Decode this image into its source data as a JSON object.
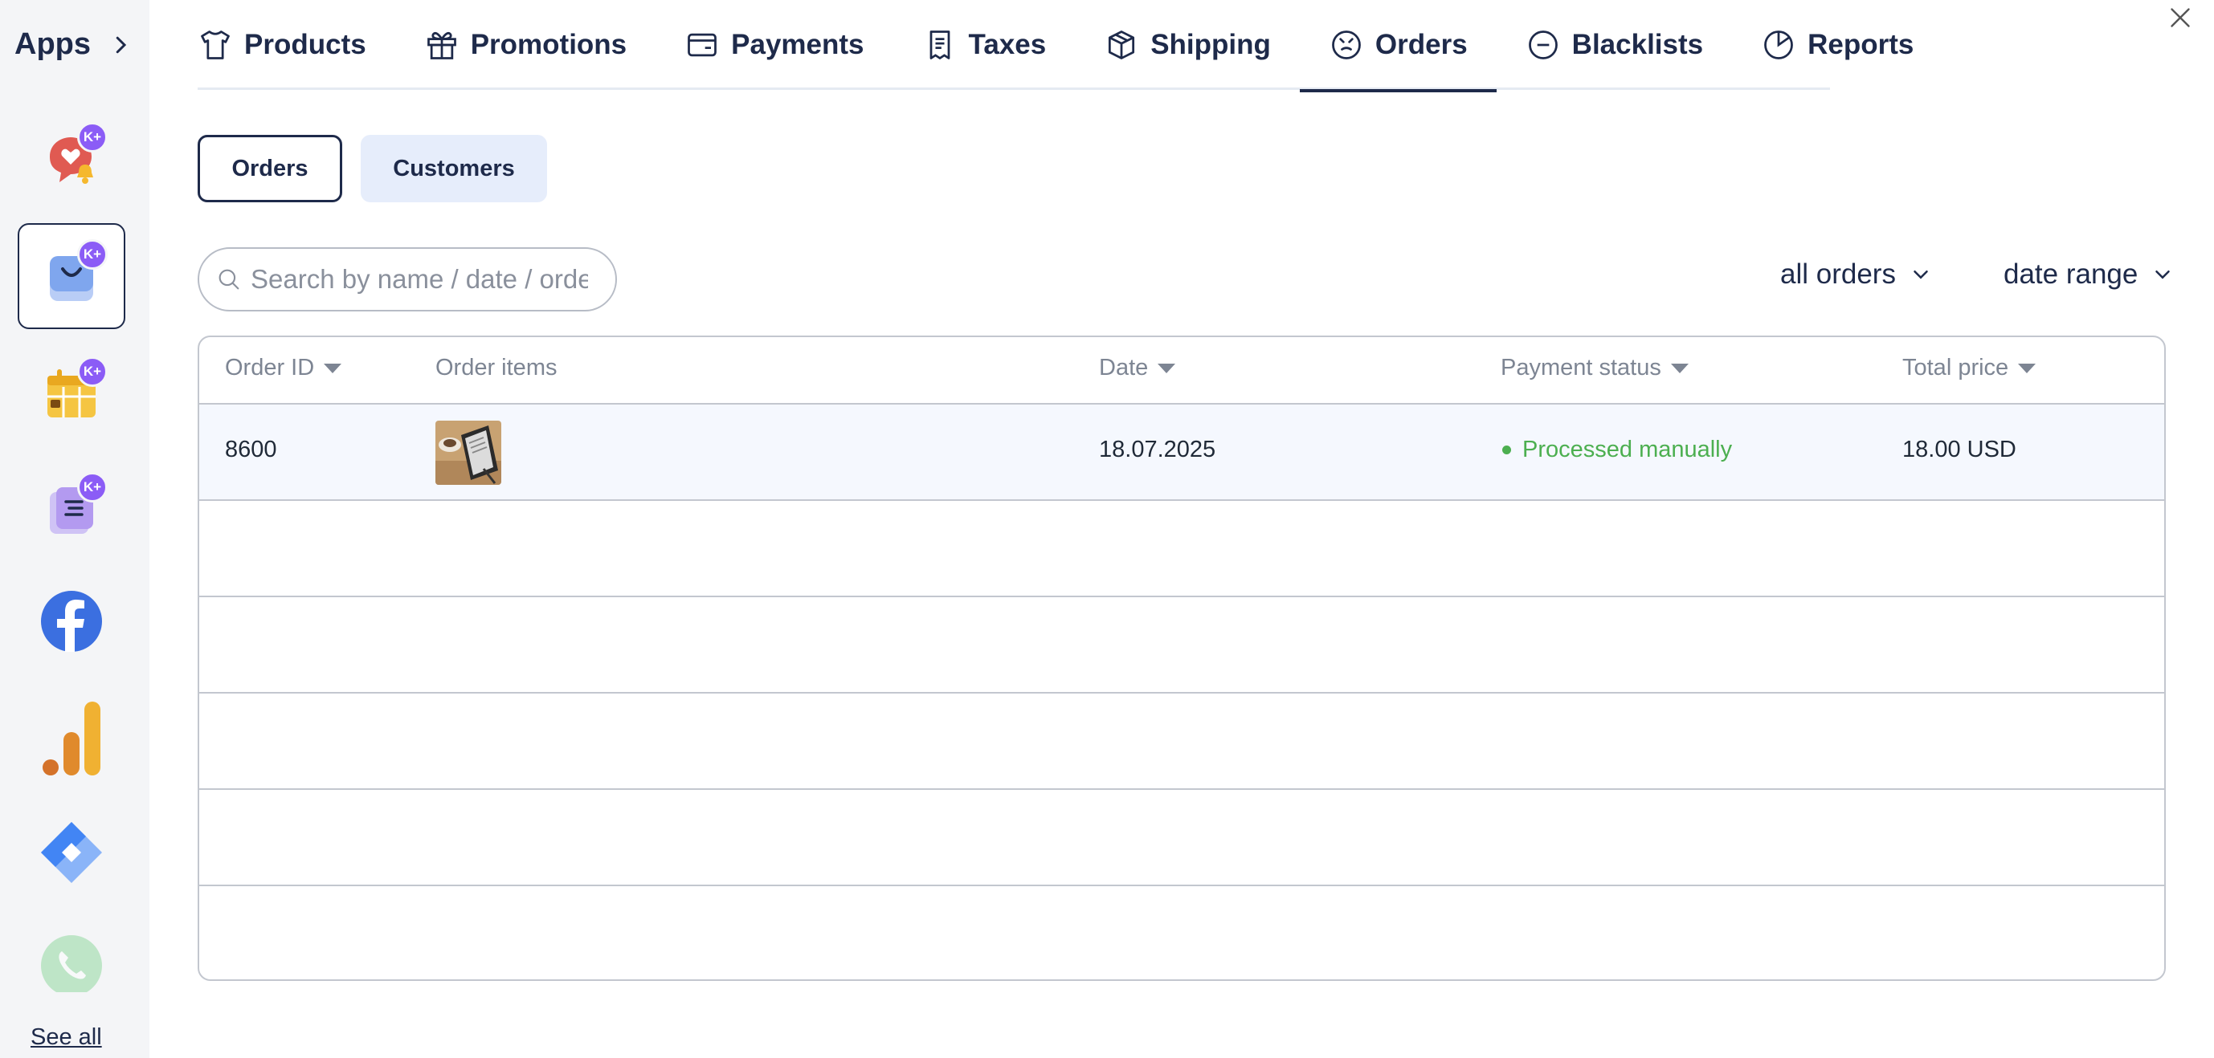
{
  "sidebar": {
    "title": "Apps",
    "badge": "K+",
    "see_all": "See all",
    "apps": [
      {
        "name": "heart-chat-app-icon"
      },
      {
        "name": "shopping-bag-app-icon"
      },
      {
        "name": "calendar-app-icon"
      },
      {
        "name": "document-app-icon"
      },
      {
        "name": "facebook-icon"
      },
      {
        "name": "analytics-icon"
      },
      {
        "name": "tag-manager-icon"
      },
      {
        "name": "whatsapp-icon"
      }
    ]
  },
  "tabs": [
    {
      "label": "Products",
      "icon": "tshirt-icon"
    },
    {
      "label": "Promotions",
      "icon": "gift-icon"
    },
    {
      "label": "Payments",
      "icon": "wallet-icon"
    },
    {
      "label": "Taxes",
      "icon": "receipt-icon"
    },
    {
      "label": "Shipping",
      "icon": "box-icon"
    },
    {
      "label": "Orders",
      "icon": "orders-icon",
      "active": true
    },
    {
      "label": "Blacklists",
      "icon": "minus-circle-icon"
    },
    {
      "label": "Reports",
      "icon": "pie-chart-icon"
    }
  ],
  "subtabs": {
    "orders": "Orders",
    "customers": "Customers"
  },
  "search": {
    "placeholder": "Search by name / date / order ID"
  },
  "filters": {
    "status": "all orders",
    "date": "date range"
  },
  "table": {
    "columns": {
      "order_id": "Order ID",
      "items": "Order items",
      "date": "Date",
      "payment_status": "Payment status",
      "total": "Total price"
    },
    "rows": [
      {
        "order_id": "8600",
        "date": "18.07.2025",
        "payment_status": "Processed manually",
        "total": "18.00 USD"
      }
    ]
  },
  "colors": {
    "accent": "#1e2a4a",
    "status_ok": "#4caf50",
    "badge": "#8b5cf6"
  }
}
